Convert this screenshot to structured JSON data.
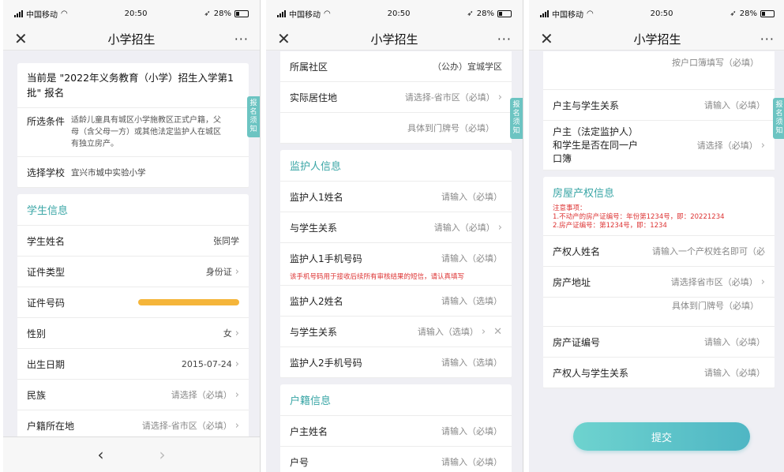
{
  "status_bar": {
    "carrier": "中国移动",
    "time": "20:50",
    "battery": "28%"
  },
  "nav": {
    "title": "小学招生",
    "close": "✕",
    "more": "···",
    "back": "‹",
    "forward": "›"
  },
  "notice_label": "报名须知",
  "panel1": {
    "intro": "当前是 \"2022年义务教育（小学）招生入学第1批\" 报名",
    "condition_label": "所选条件",
    "condition_text": "适龄儿童具有城区小学施教区正式户籍，父母（含父母一方）或其他法定监护人在城区有独立房产。",
    "school_label": "选择学校",
    "school_value": "宜兴市城中实验小学",
    "student_section": "学生信息",
    "fields": [
      {
        "label": "学生姓名",
        "value": "张同学"
      },
      {
        "label": "证件类型",
        "value": "身份证"
      },
      {
        "label": "证件号码",
        "value": ""
      },
      {
        "label": "性别",
        "value": "女"
      },
      {
        "label": "出生日期",
        "value": "2015-07-24"
      },
      {
        "label": "民族",
        "value": "请选择（必填）"
      },
      {
        "label": "户籍所在地",
        "value": "请选择-省市区（必填）"
      }
    ]
  },
  "panel2": {
    "community_label": "所属社区",
    "community_value": "（公办）宜城学区",
    "residence_label": "实际居住地",
    "residence_value": "请选择-省市区（必填）",
    "residence_detail": "具体到门牌号（必填）",
    "guardian_section": "监护人信息",
    "g1_name_label": "监护人1姓名",
    "g1_name_value": "请输入（必填）",
    "g1_rel_label": "与学生关系",
    "g1_rel_value": "请输入（必填）",
    "g1_phone_label": "监护人1手机号码",
    "g1_phone_value": "请输入（必填）",
    "phone_tip": "该手机号码用于接收后续所有审核结果的短信，请认真填写",
    "g2_name_label": "监护人2姓名",
    "g2_name_value": "请输入（选填）",
    "g2_rel_label": "与学生关系",
    "g2_rel_value": "请输入（选填）",
    "g2_phone_label": "监护人2手机号码",
    "g2_phone_value": "请输入（选填）",
    "household_section": "户籍信息",
    "owner_label": "户主姓名",
    "owner_value": "请输入（必填）",
    "hukou_label": "户号",
    "hukou_value": "请输入（必填）"
  },
  "panel3": {
    "top_hint": "按户口簿填写（必填）",
    "rel_label": "户主与学生关系",
    "rel_value": "请输入（必填）",
    "same_label": "户主（法定监护人）和学生是否在同一户口簿",
    "same_value": "请选择（必填）",
    "property_section": "房屋产权信息",
    "note_title": "注意事项：",
    "note_1": "1.不动产的房产证编号：年份第1234号，即：20221234",
    "note_2": "2.房产证编号：第1234号，即：1234",
    "holder_label": "产权人姓名",
    "holder_value": "请输入一个产权姓名即可（必",
    "address_label": "房产地址",
    "address_value": "请选择省市区（必填）",
    "address_detail": "具体到门牌号（必填）",
    "cert_label": "房产证编号",
    "cert_value": "请输入（必填）",
    "holder_rel_label": "产权人与学生关系",
    "holder_rel_value": "请输入（必填）",
    "submit": "提交"
  }
}
